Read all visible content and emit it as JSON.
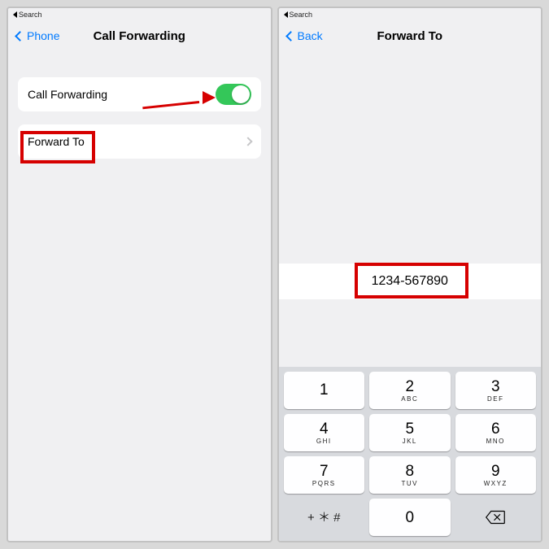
{
  "left": {
    "breadcrumb": "Search",
    "back_label": "Phone",
    "title": "Call Forwarding",
    "row1_label": "Call Forwarding",
    "row2_label": "Forward To"
  },
  "right": {
    "breadcrumb": "Search",
    "back_label": "Back",
    "title": "Forward To",
    "number": "1234-567890",
    "keypad": {
      "k1": "1",
      "k1l": "",
      "k2": "2",
      "k2l": "ABC",
      "k3": "3",
      "k3l": "DEF",
      "k4": "4",
      "k4l": "GHI",
      "k5": "5",
      "k5l": "JKL",
      "k6": "6",
      "k6l": "MNO",
      "k7": "7",
      "k7l": "PQRS",
      "k8": "8",
      "k8l": "TUV",
      "k9": "9",
      "k9l": "WXYZ",
      "k0": "0",
      "symbols": "+ ＊ #"
    }
  }
}
